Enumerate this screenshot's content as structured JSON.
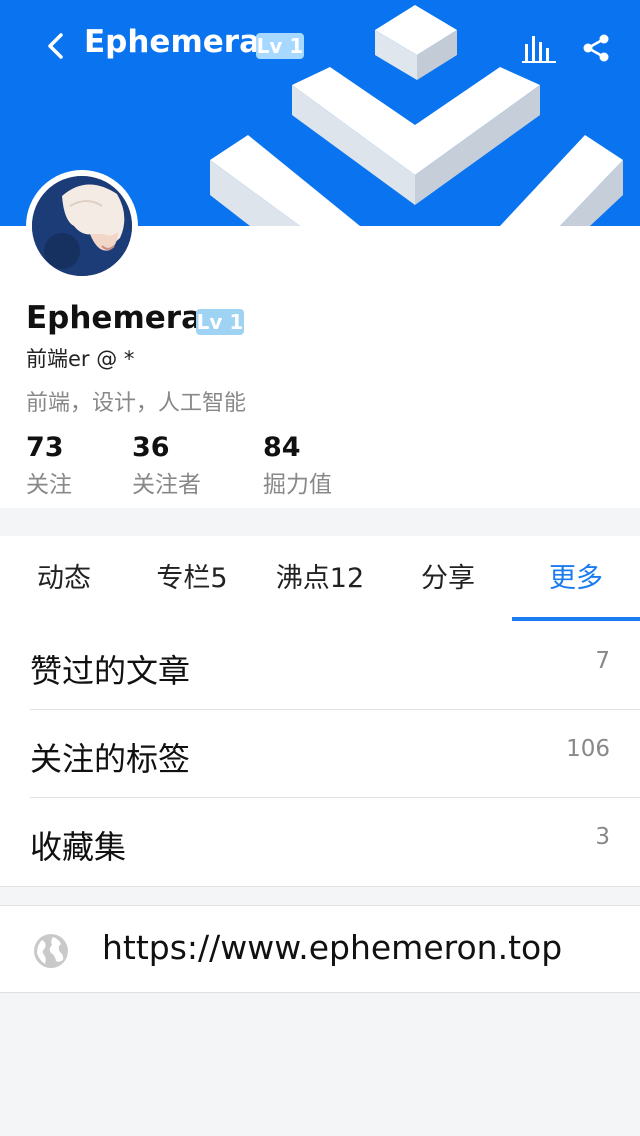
{
  "header": {
    "title": "Ephemera",
    "level": "Lv 1",
    "back_icon": "chevron-left-icon",
    "stats_icon": "bar-chart-icon",
    "share_icon": "share-icon",
    "banner_color": "#0a74f0"
  },
  "profile": {
    "name": "Ephemera",
    "level": "Lv 1",
    "job": "前端er @ *",
    "interests": "前端，设计，人工智能",
    "stats": [
      {
        "value": "73",
        "label": "关注"
      },
      {
        "value": "36",
        "label": "关注者"
      },
      {
        "value": "84",
        "label": "掘力值"
      }
    ]
  },
  "tabs": [
    {
      "label": "动态"
    },
    {
      "label": "专栏5"
    },
    {
      "label": "沸点12"
    },
    {
      "label": "分享"
    },
    {
      "label": "更多",
      "active": true
    }
  ],
  "list": [
    {
      "label": "赞过的文章",
      "count": "7"
    },
    {
      "label": "关注的标签",
      "count": "106"
    },
    {
      "label": "收藏集",
      "count": "3"
    }
  ],
  "website": {
    "url": "https://www.ephemeron.top",
    "icon": "globe-icon"
  },
  "colors": {
    "accent": "#1a7cf0",
    "muted_text": "#888888",
    "background": "#f4f5f7"
  }
}
